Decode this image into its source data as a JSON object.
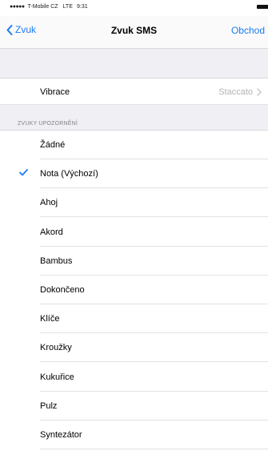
{
  "status_bar": {
    "signal_dots": "●●●●●",
    "carrier": "T-Mobile CZ",
    "network": "LTE",
    "time": "9:31"
  },
  "nav": {
    "back_label": "Zvuk",
    "title": "Zvuk SMS",
    "right_label": "Obchod",
    "accent_color": "#1b7cf5"
  },
  "vibration": {
    "label": "Vibrace",
    "value": "Staccato"
  },
  "section": {
    "header": "ZVUKY UPOZORNĚNÍ"
  },
  "tones": [
    {
      "label": "Žádné",
      "selected": false
    },
    {
      "label": "Nota (Výchozí)",
      "selected": true
    },
    {
      "label": "Ahoj",
      "selected": false
    },
    {
      "label": "Akord",
      "selected": false
    },
    {
      "label": "Bambus",
      "selected": false
    },
    {
      "label": "Dokončeno",
      "selected": false
    },
    {
      "label": "Klíče",
      "selected": false
    },
    {
      "label": "Kroužky",
      "selected": false
    },
    {
      "label": "Kukuřice",
      "selected": false
    },
    {
      "label": "Pulz",
      "selected": false
    },
    {
      "label": "Syntezátor",
      "selected": false
    }
  ]
}
